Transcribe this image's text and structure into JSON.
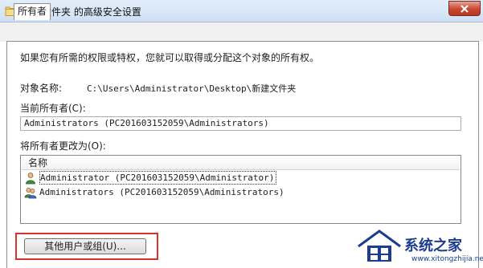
{
  "window": {
    "title": "新建文件夹 的高级安全设置"
  },
  "tabs": [
    {
      "label": "所有者"
    }
  ],
  "main": {
    "intro": "如果您有所需的权限或特权，您就可以取得或分配这个对象的所有权。",
    "object_name_label": "对象名称:",
    "object_name_value": "C:\\Users\\Administrator\\Desktop\\新建文件夹",
    "current_owner_label": "当前所有者(C):",
    "current_owner_value": "Administrators (PC201603152059\\Administrators)",
    "change_owner_label": "将所有者更改为(O):",
    "list": {
      "header": "名称",
      "rows": [
        {
          "label": "Administrator (PC201603152059\\Administrator)",
          "icon": "user-icon"
        },
        {
          "label": "Administrators (PC201603152059\\Administrators)",
          "icon": "group-icon"
        }
      ]
    },
    "other_users_button": "其他用户或组(U)..."
  },
  "watermark": {
    "text": "系统之家",
    "url": "www.xitongzhijia.net"
  },
  "colors": {
    "highlight": "#d8322b",
    "watermark": "#1b3c8f"
  }
}
